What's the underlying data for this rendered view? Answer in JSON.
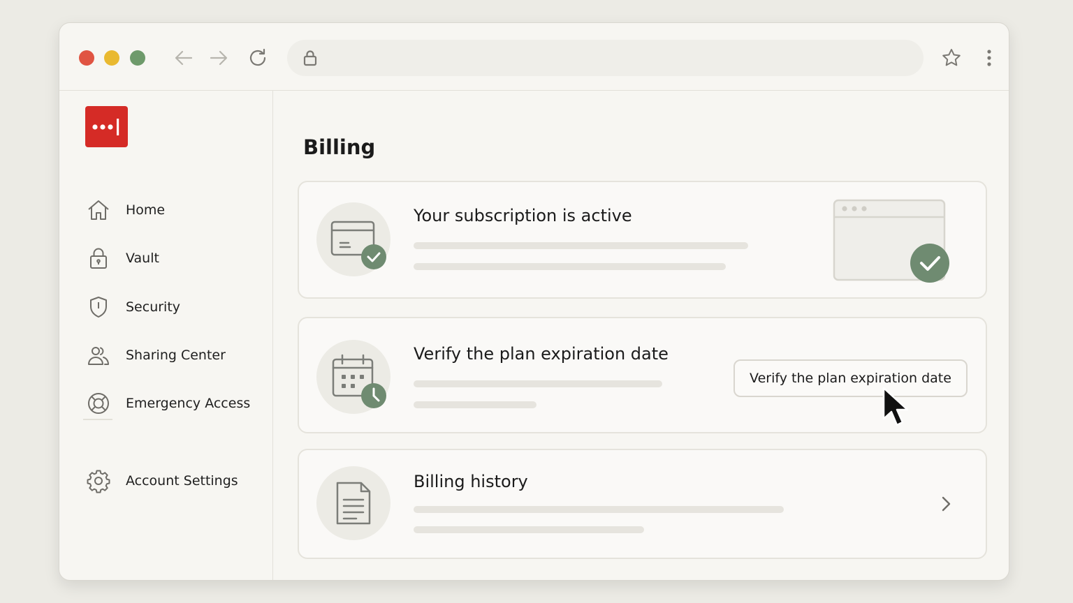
{
  "browser": {
    "traffic_lights": {
      "close": "#e05442",
      "minimize": "#e9b930",
      "maximize": "#6e9a6b"
    },
    "icons": [
      "back-arrow-icon",
      "forward-arrow-icon",
      "reload-icon",
      "lock-icon",
      "star-icon",
      "kebab-menu-icon"
    ]
  },
  "sidebar": {
    "logo_color": "#d52b26",
    "items": [
      {
        "label": "Home",
        "icon": "home-icon"
      },
      {
        "label": "Vault",
        "icon": "lock-icon"
      },
      {
        "label": "Security",
        "icon": "shield-icon"
      },
      {
        "label": "Sharing Center",
        "icon": "users-icon"
      },
      {
        "label": "Emergency Access",
        "icon": "lifebuoy-icon"
      }
    ],
    "footer_items": [
      {
        "label": "Account Settings",
        "icon": "gear-icon"
      }
    ]
  },
  "main": {
    "title": "Billing",
    "accent_color": "#6f8b71",
    "cards": [
      {
        "title": "Your subscription is active",
        "icon": "credit-card-check-icon"
      },
      {
        "title": "Verify the plan expiration date",
        "icon": "calendar-clock-icon",
        "button_label": "Verify the plan expiration date"
      },
      {
        "title": "Billing history",
        "icon": "document-icon"
      }
    ]
  }
}
